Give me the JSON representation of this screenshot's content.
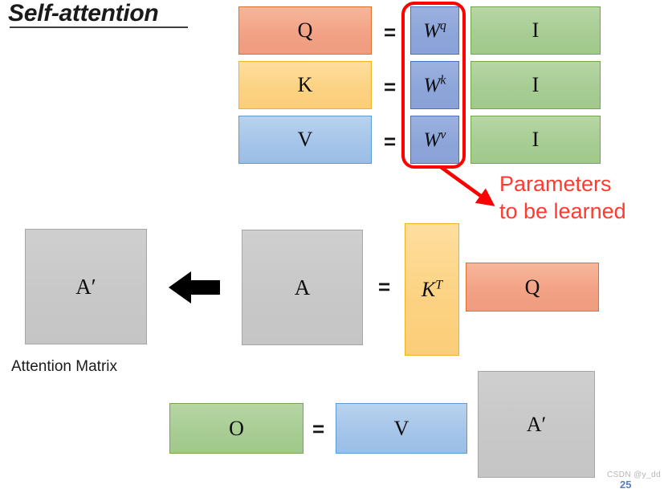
{
  "slide": {
    "title": "Self-attention",
    "slide_number": "25",
    "watermark": "CSDN @y_dd",
    "background_color": "#ffffff"
  },
  "colors": {
    "salmon": "#F2A286",
    "salmon_border": "#E0702C",
    "gold": "#FCD383",
    "gold_border": "#F0B323",
    "blue": "#A5C5E9",
    "blue_border": "#5B9BD5",
    "green": "#A7CD93",
    "green_border": "#70A84B",
    "weight_blue": "#8DA5D9",
    "weight_blue_border": "#4A6FC0",
    "gray": "#C8C8C8",
    "gray_border": "#A6A6A6",
    "highlight_red": "#FF0000",
    "note_red": "#FF3B30",
    "slide_number_blue": "#5B7EC2"
  },
  "equations": {
    "qkv_rows": [
      {
        "name": "query-equation",
        "left_label": "Q",
        "left_color": "salmon",
        "operator": "=",
        "weight_label": "W",
        "weight_exponent": "q",
        "input_label": "I"
      },
      {
        "name": "key-equation",
        "left_label": "K",
        "left_color": "gold",
        "operator": "=",
        "weight_label": "W",
        "weight_exponent": "k",
        "input_label": "I"
      },
      {
        "name": "value-equation",
        "left_label": "V",
        "left_color": "blue",
        "operator": "=",
        "weight_label": "W",
        "weight_exponent": "v",
        "input_label": "I"
      }
    ],
    "attention_row": {
      "name": "attention-equation",
      "result_label": "A′",
      "result_caption": "Attention Matrix",
      "arrow": "left-arrow",
      "a_label": "A",
      "operator": "=",
      "kt_label": "K",
      "kt_exponent": "T",
      "q_label": "Q"
    },
    "output_row": {
      "name": "output-equation",
      "o_label": "O",
      "operator": "=",
      "v_label": "V",
      "aprime_label": "A′"
    }
  },
  "callout": {
    "text": "Parameters\nto be learned",
    "highlight_target": "weight-matrices-column"
  }
}
